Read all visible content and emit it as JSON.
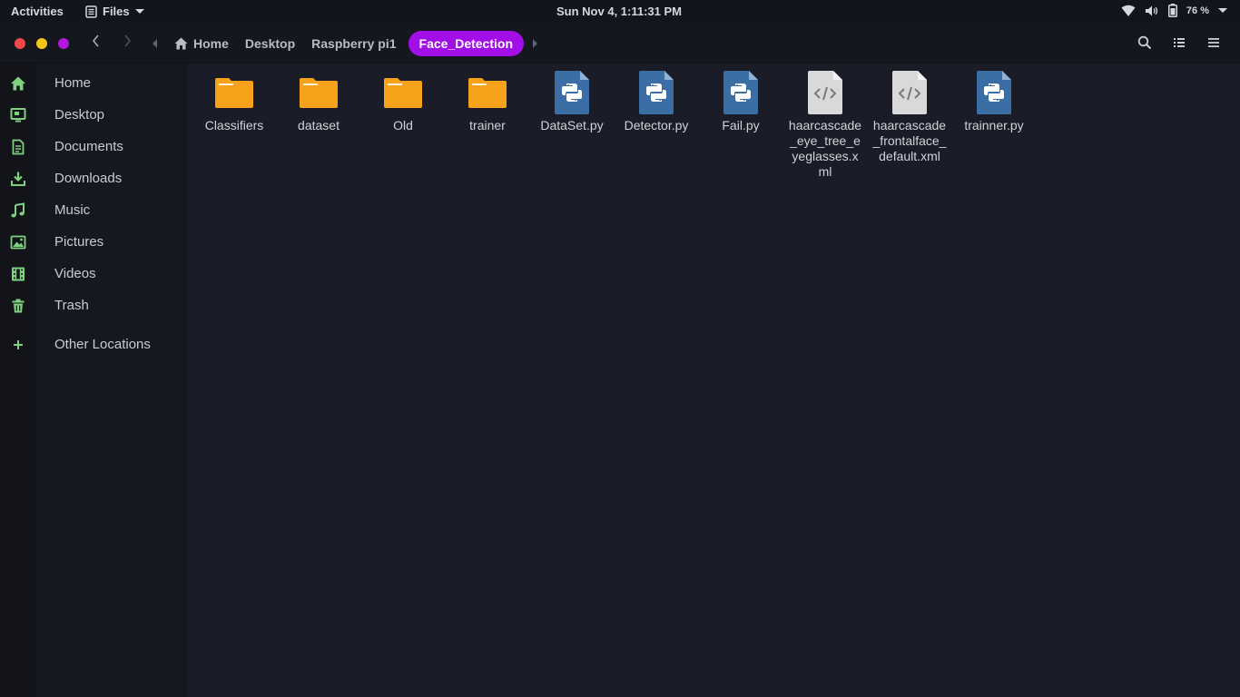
{
  "topbar": {
    "activities": "Activities",
    "app_menu": "Files",
    "clock": "Sun Nov  4,  1:11:31 PM",
    "battery_percent": "76 %"
  },
  "colors": {
    "close": "#f24848",
    "minimize": "#f5c518",
    "maximize": "#b417e0",
    "accent": "#a10fe6",
    "folder": "#f7a21b",
    "python_file": "#3a6ea5",
    "xml_file": "#d9d9d9",
    "sidebar_icon": "#7fd17f"
  },
  "breadcrumbs": [
    "Home",
    "Desktop",
    "Raspberry pi1",
    "Face_Detection"
  ],
  "header_icons": [
    "back-icon",
    "forward-icon",
    "search-icon",
    "list-view-icon",
    "menu-icon"
  ],
  "sidebar": {
    "items": [
      {
        "label": "Home",
        "icon": "home-icon"
      },
      {
        "label": "Desktop",
        "icon": "desktop-icon"
      },
      {
        "label": "Documents",
        "icon": "document-icon"
      },
      {
        "label": "Downloads",
        "icon": "download-icon"
      },
      {
        "label": "Music",
        "icon": "music-icon"
      },
      {
        "label": "Pictures",
        "icon": "picture-icon"
      },
      {
        "label": "Videos",
        "icon": "video-icon"
      },
      {
        "label": "Trash",
        "icon": "trash-icon"
      }
    ],
    "other_locations": "Other Locations"
  },
  "files": [
    {
      "name": "Classifiers",
      "type": "folder"
    },
    {
      "name": "dataset",
      "type": "folder"
    },
    {
      "name": "Old",
      "type": "folder"
    },
    {
      "name": "trainer",
      "type": "folder"
    },
    {
      "name": "DataSet.py",
      "type": "python"
    },
    {
      "name": "Detector.py",
      "type": "python"
    },
    {
      "name": "Fail.py",
      "type": "python"
    },
    {
      "name": "haarcascade_eye_tree_eyeglasses.xml",
      "type": "xml"
    },
    {
      "name": "haarcascade_frontalface_default.xml",
      "type": "xml"
    },
    {
      "name": "trainner.py",
      "type": "python"
    }
  ]
}
